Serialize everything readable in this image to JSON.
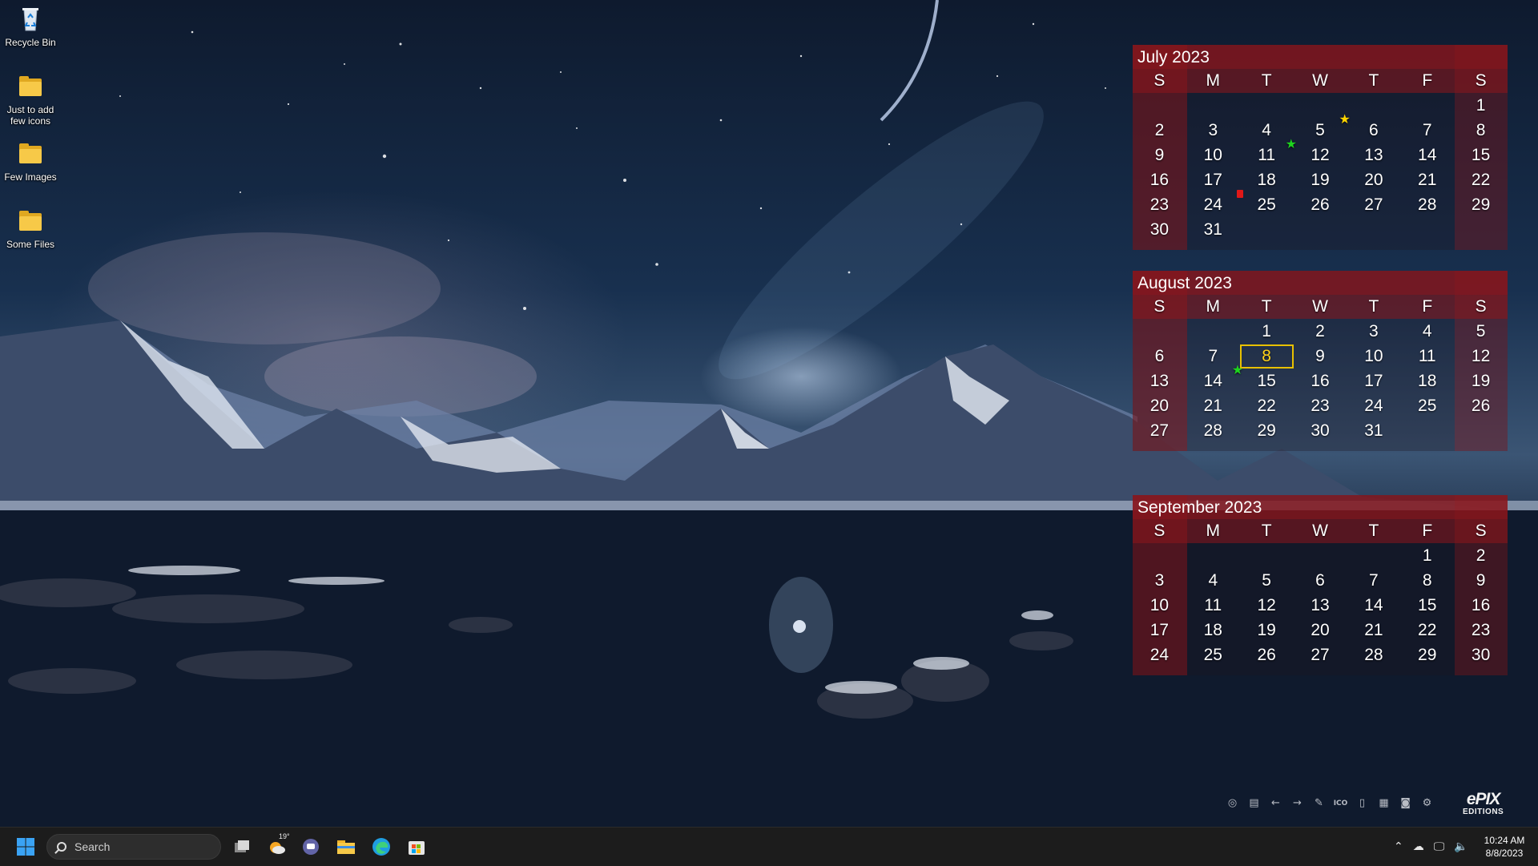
{
  "desktop": {
    "icons": [
      {
        "label": "Recycle Bin"
      },
      {
        "label": "Just to add few icons"
      },
      {
        "label": "Few Images"
      },
      {
        "label": "Some Files"
      }
    ]
  },
  "calendar": {
    "day_headers": [
      "S",
      "M",
      "T",
      "W",
      "T",
      "F",
      "S"
    ],
    "months": [
      {
        "title": "July 2023",
        "weeks": [
          [
            "",
            "",
            "",
            "",
            "",
            "",
            "1"
          ],
          [
            "2",
            "3",
            "4",
            "5",
            "6",
            "7",
            "8"
          ],
          [
            "9",
            "10",
            "11",
            "12",
            "13",
            "14",
            "15"
          ],
          [
            "16",
            "17",
            "18",
            "19",
            "20",
            "21",
            "22"
          ],
          [
            "23",
            "24",
            "25",
            "26",
            "27",
            "28",
            "29"
          ],
          [
            "30",
            "31",
            "",
            "",
            "",
            "",
            ""
          ]
        ]
      },
      {
        "title": "August 2023",
        "weeks": [
          [
            "",
            "",
            "1",
            "2",
            "3",
            "4",
            "5"
          ],
          [
            "6",
            "7",
            "8",
            "9",
            "10",
            "11",
            "12"
          ],
          [
            "13",
            "14",
            "15",
            "16",
            "17",
            "18",
            "19"
          ],
          [
            "20",
            "21",
            "22",
            "23",
            "24",
            "25",
            "26"
          ],
          [
            "27",
            "28",
            "29",
            "30",
            "31",
            "",
            ""
          ]
        ]
      },
      {
        "title": "September 2023",
        "weeks": [
          [
            "",
            "",
            "",
            "",
            "",
            "1",
            "2"
          ],
          [
            "3",
            "4",
            "5",
            "6",
            "7",
            "8",
            "9"
          ],
          [
            "10",
            "11",
            "12",
            "13",
            "14",
            "15",
            "16"
          ],
          [
            "17",
            "18",
            "19",
            "20",
            "21",
            "22",
            "23"
          ],
          [
            "24",
            "25",
            "26",
            "27",
            "28",
            "29",
            "30"
          ]
        ]
      }
    ],
    "today": {
      "month": "August 2023",
      "day": "8"
    },
    "markers": [
      {
        "month": "July 2023",
        "day": "6",
        "type": "star",
        "color": "#ffd400"
      },
      {
        "month": "July 2023",
        "day": "12",
        "type": "star",
        "color": "#1ed41e"
      },
      {
        "month": "July 2023",
        "day": "25",
        "type": "flag",
        "color": "#e01818"
      },
      {
        "month": "August 2023",
        "day": "15",
        "type": "star",
        "color": "#1ed41e"
      }
    ],
    "colors": {
      "header": "#8c161c",
      "today_outline": "#e8c000"
    }
  },
  "widget_toolbar": {
    "buttons": [
      "target-icon",
      "print-icon",
      "back-arrow-icon",
      "forward-arrow-icon",
      "paint-icon",
      "ico-icon",
      "notes-icon",
      "grid-icon",
      "camera-icon",
      "settings-icon"
    ],
    "ico_text": "ICO",
    "brand_line1": "ePIX",
    "brand_line2": "EDITIONS"
  },
  "taskbar": {
    "search_label": "Search",
    "weather_temp": "19°",
    "apps": [
      "task-view-icon",
      "weather-icon",
      "teams-chat-icon",
      "file-explorer-icon",
      "edge-icon",
      "store-icon"
    ],
    "clock_time": "10:24 AM",
    "clock_date": "8/8/2023"
  }
}
